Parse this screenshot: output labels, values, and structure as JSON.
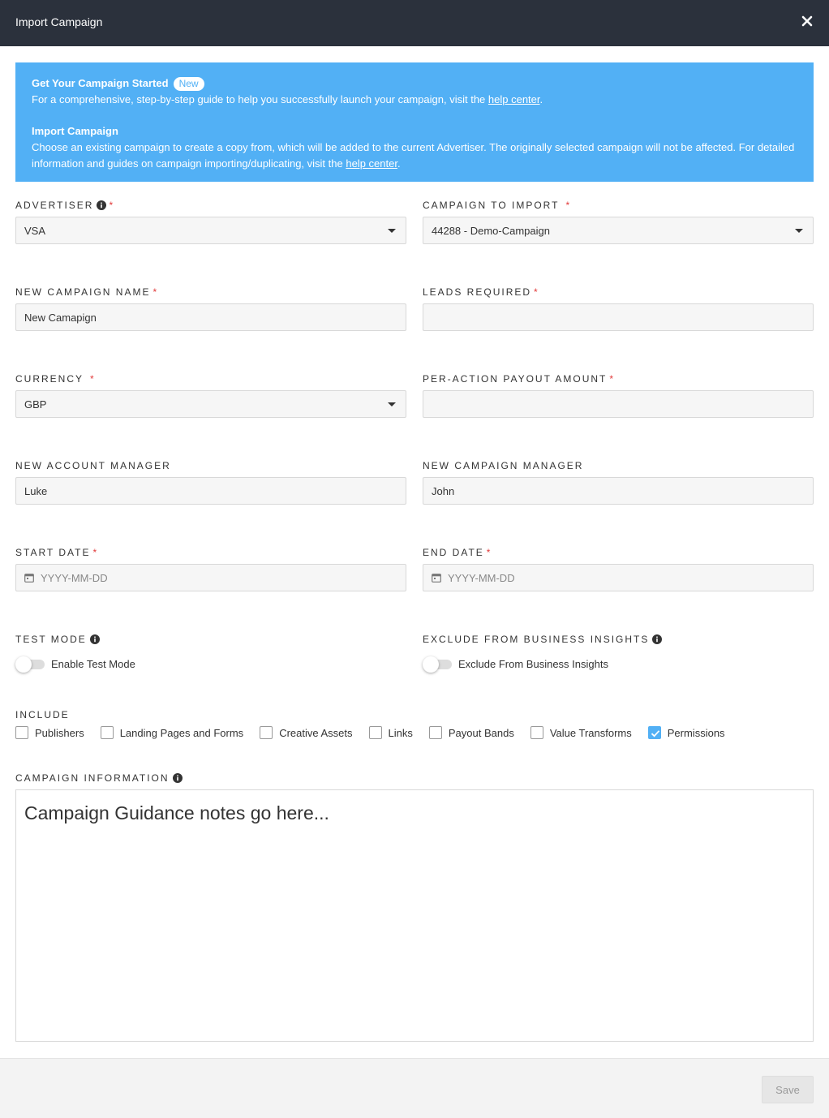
{
  "header": {
    "title": "Import Campaign"
  },
  "banner": {
    "heading1": "Get Your Campaign Started",
    "badge": "New",
    "text1_pre": "For a comprehensive, step-by-step guide to help you successfully launch your campaign, visit the ",
    "text1_link": "help center",
    "text1_post": ".",
    "heading2": "Import Campaign",
    "text2_pre": "Choose an existing campaign to create a copy from, which will be added to the current Advertiser. The originally selected campaign will not be affected. For detailed information and guides on campaign importing/duplicating, visit the ",
    "text2_link": "help center",
    "text2_post": "."
  },
  "form": {
    "advertiser": {
      "label": "ADVERTISER",
      "value": "VSA"
    },
    "campaign_to_import": {
      "label": "CAMPAIGN TO IMPORT",
      "value": "44288 - Demo-Campaign"
    },
    "new_campaign_name": {
      "label": "NEW CAMPAIGN NAME",
      "value": "New Camapign"
    },
    "leads_required": {
      "label": "LEADS REQUIRED",
      "value": ""
    },
    "currency": {
      "label": "CURRENCY",
      "value": "GBP"
    },
    "payout_amount": {
      "label": "PER-ACTION PAYOUT AMOUNT",
      "value": ""
    },
    "account_manager": {
      "label": "NEW ACCOUNT MANAGER",
      "value": "Luke"
    },
    "campaign_manager": {
      "label": "NEW CAMPAIGN MANAGER",
      "value": "John"
    },
    "start_date": {
      "label": "START DATE",
      "placeholder": "YYYY-MM-DD"
    },
    "end_date": {
      "label": "END DATE",
      "placeholder": "YYYY-MM-DD"
    },
    "test_mode": {
      "label": "TEST MODE",
      "toggle_label": "Enable Test Mode",
      "enabled": false
    },
    "exclude_insights": {
      "label": "EXCLUDE FROM BUSINESS INSIGHTS",
      "toggle_label": "Exclude From Business Insights",
      "enabled": false
    },
    "include": {
      "label": "INCLUDE",
      "options": [
        {
          "label": "Publishers",
          "checked": false
        },
        {
          "label": "Landing Pages and Forms",
          "checked": false
        },
        {
          "label": "Creative Assets",
          "checked": false
        },
        {
          "label": "Links",
          "checked": false
        },
        {
          "label": "Payout Bands",
          "checked": false
        },
        {
          "label": "Value Transforms",
          "checked": false
        },
        {
          "label": "Permissions",
          "checked": true
        }
      ]
    },
    "campaign_info": {
      "label": "CAMPAIGN INFORMATION",
      "value": "Campaign Guidance notes go here..."
    },
    "required_mark": "*"
  },
  "footer": {
    "save_label": "Save"
  },
  "colors": {
    "header_bg": "#2b313c",
    "banner_bg": "#52b0f5",
    "required": "#e23a3a",
    "check_accent": "#52b0f5"
  }
}
